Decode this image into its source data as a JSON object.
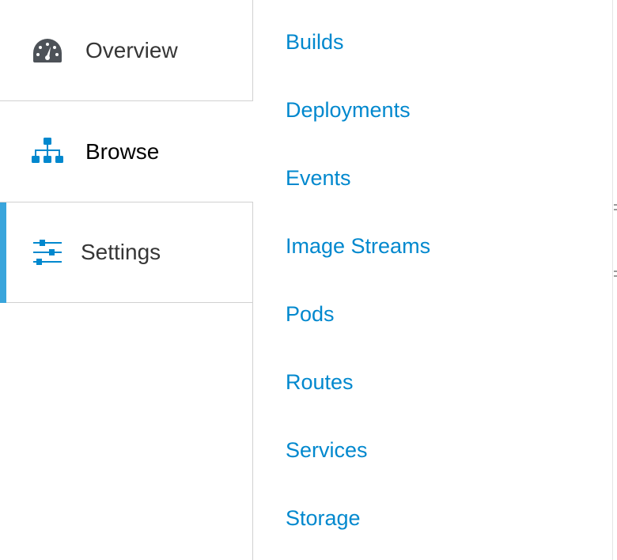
{
  "primary_nav": {
    "items": [
      {
        "label": "Overview",
        "icon": "dashboard-gauge-icon",
        "active": false
      },
      {
        "label": "Browse",
        "icon": "sitemap-icon",
        "active": false
      },
      {
        "label": "Settings",
        "icon": "sliders-icon",
        "active": true
      }
    ]
  },
  "secondary_nav": {
    "links": [
      {
        "label": "Builds"
      },
      {
        "label": "Deployments"
      },
      {
        "label": "Events"
      },
      {
        "label": "Image Streams"
      },
      {
        "label": "Pods"
      },
      {
        "label": "Routes"
      },
      {
        "label": "Services"
      },
      {
        "label": "Storage"
      }
    ]
  },
  "colors": {
    "accent": "#39a5dc",
    "link": "#0088ce",
    "icon_gray": "#4d5258",
    "text": "#363636",
    "divider": "#d1d1d1"
  }
}
